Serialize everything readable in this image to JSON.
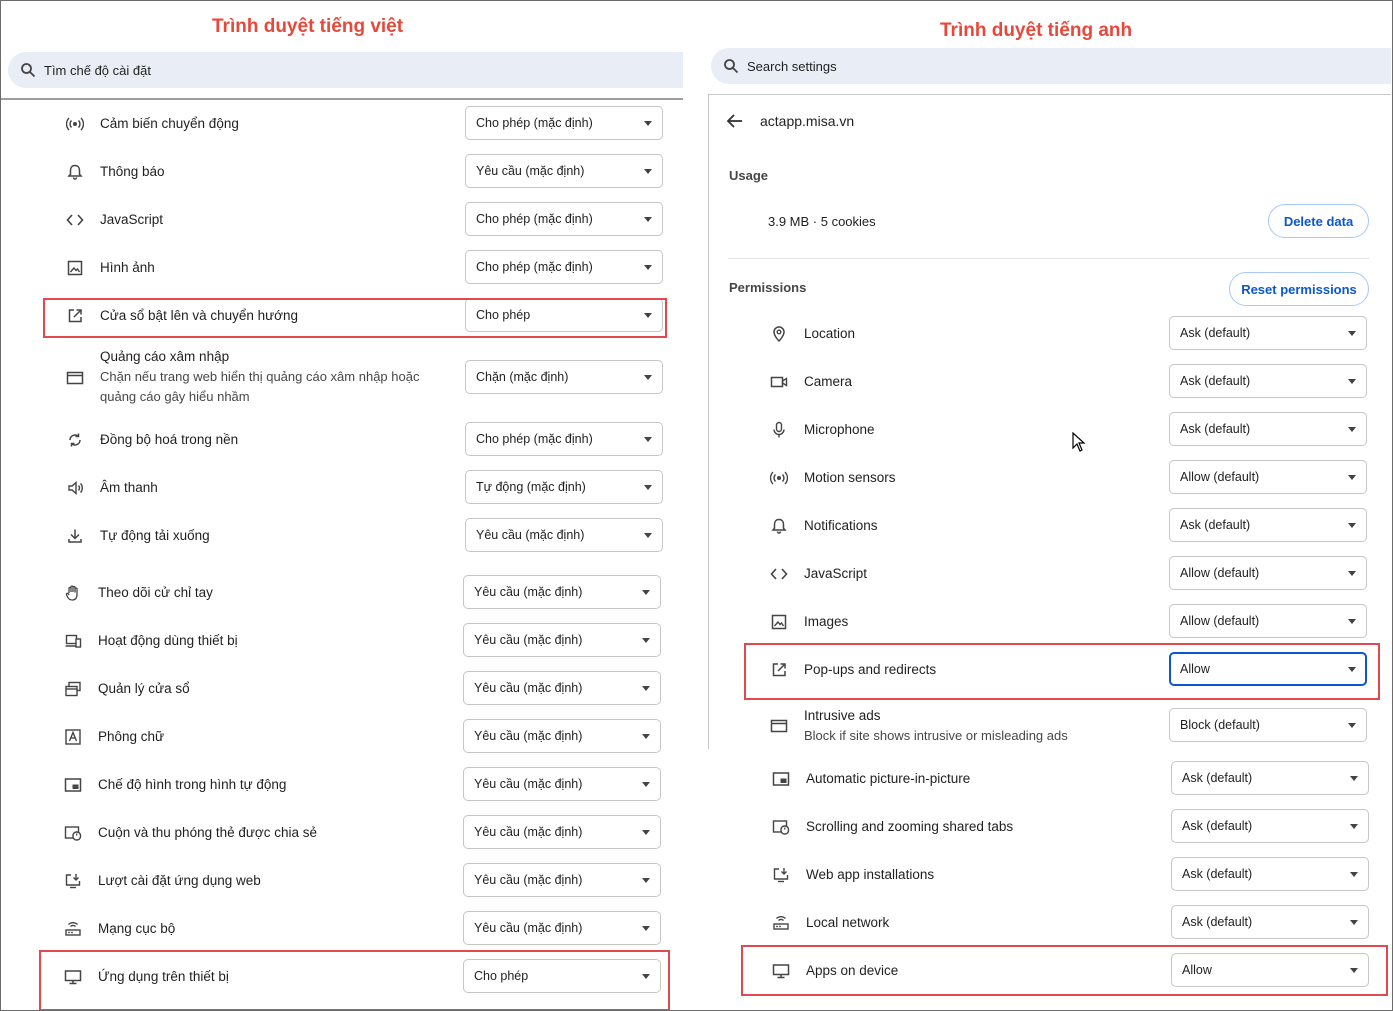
{
  "captions": {
    "left": "Trình duyệt tiếng việt",
    "right": "Trình duyệt tiếng anh"
  },
  "left": {
    "search_placeholder": "Tìm chế độ cài đặt",
    "rows": [
      {
        "label": "Cảm biến chuyển động",
        "value": "Cho phép (mặc định)",
        "icon": "motion-sensors-icon"
      },
      {
        "label": "Thông báo",
        "value": "Yêu cầu (mặc định)",
        "icon": "bell-icon"
      },
      {
        "label": "JavaScript",
        "value": "Cho phép (mặc định)",
        "icon": "code-icon"
      },
      {
        "label": "Hình ảnh",
        "value": "Cho phép (mặc định)",
        "icon": "image-icon"
      },
      {
        "label": "Cửa sổ bật lên và chuyển hướng",
        "value": "Cho phép",
        "icon": "popup-icon"
      },
      {
        "label": "Quảng cáo xâm nhập",
        "sub1": "Chặn nếu trang web hiển thị quảng cáo xâm nhập hoặc",
        "sub2": "quảng cáo gây hiểu nhầm",
        "value": "Chặn (mặc định)",
        "icon": "ads-icon"
      },
      {
        "label": "Đồng bộ hoá trong nền",
        "value": "Cho phép (mặc định)",
        "icon": "sync-icon"
      },
      {
        "label": "Âm thanh",
        "value": "Tự động (mặc định)",
        "icon": "sound-icon"
      },
      {
        "label": "Tự động tải xuống",
        "value": "Yêu cầu (mặc định)",
        "icon": "download-icon"
      },
      {
        "label": "Theo dõi cử chỉ tay",
        "value": "Yêu cầu (mặc định)",
        "icon": "hand-icon"
      },
      {
        "label": "Hoạt động dùng thiết bị",
        "value": "Yêu cầu (mặc định)",
        "icon": "device-usage-icon"
      },
      {
        "label": "Quản lý cửa sổ",
        "value": "Yêu cầu (mặc định)",
        "icon": "window-icon"
      },
      {
        "label": "Phông chữ",
        "value": "Yêu cầu (mặc định)",
        "icon": "font-icon"
      },
      {
        "label": "Chế độ hình trong hình tự động",
        "value": "Yêu cầu (mặc định)",
        "icon": "pip-icon"
      },
      {
        "label": "Cuộn và thu phóng thẻ được chia sẻ",
        "value": "Yêu cầu (mặc định)",
        "icon": "scroll-zoom-icon"
      },
      {
        "label": "Lượt cài đặt ứng dụng web",
        "value": "Yêu cầu (mặc định)",
        "icon": "install-icon"
      },
      {
        "label": "Mạng cục bộ",
        "value": "Yêu cầu (mặc định)",
        "icon": "router-icon"
      },
      {
        "label": "Ứng dụng trên thiết bị",
        "value": "Cho phép",
        "icon": "monitor-icon"
      }
    ]
  },
  "right": {
    "search_placeholder": "Search settings",
    "site": "actapp.misa.vn",
    "usage_heading": "Usage",
    "usage_text": "3.9 MB · 5 cookies",
    "delete_btn": "Delete data",
    "permissions_heading": "Permissions",
    "reset_btn": "Reset permissions",
    "rows": [
      {
        "label": "Location",
        "value": "Ask (default)",
        "icon": "location-icon"
      },
      {
        "label": "Camera",
        "value": "Ask (default)",
        "icon": "camera-icon"
      },
      {
        "label": "Microphone",
        "value": "Ask (default)",
        "icon": "microphone-icon"
      },
      {
        "label": "Motion sensors",
        "value": "Allow (default)",
        "icon": "motion-sensors-icon"
      },
      {
        "label": "Notifications",
        "value": "Ask (default)",
        "icon": "bell-icon"
      },
      {
        "label": "JavaScript",
        "value": "Allow (default)",
        "icon": "code-icon"
      },
      {
        "label": "Images",
        "value": "Allow (default)",
        "icon": "image-icon"
      },
      {
        "label": "Pop-ups and redirects",
        "value": "Allow",
        "icon": "popup-icon"
      },
      {
        "label": "Intrusive ads",
        "sub1": "Block if site shows intrusive or misleading ads",
        "value": "Block (default)",
        "icon": "ads-icon"
      },
      {
        "label": "Automatic picture-in-picture",
        "value": "Ask (default)",
        "icon": "pip-icon"
      },
      {
        "label": "Scrolling and zooming shared tabs",
        "value": "Ask (default)",
        "icon": "scroll-zoom-icon"
      },
      {
        "label": "Web app installations",
        "value": "Ask (default)",
        "icon": "install-icon"
      },
      {
        "label": "Local network",
        "value": "Ask (default)",
        "icon": "router-icon"
      },
      {
        "label": "Apps on device",
        "value": "Allow",
        "icon": "monitor-icon"
      }
    ]
  }
}
